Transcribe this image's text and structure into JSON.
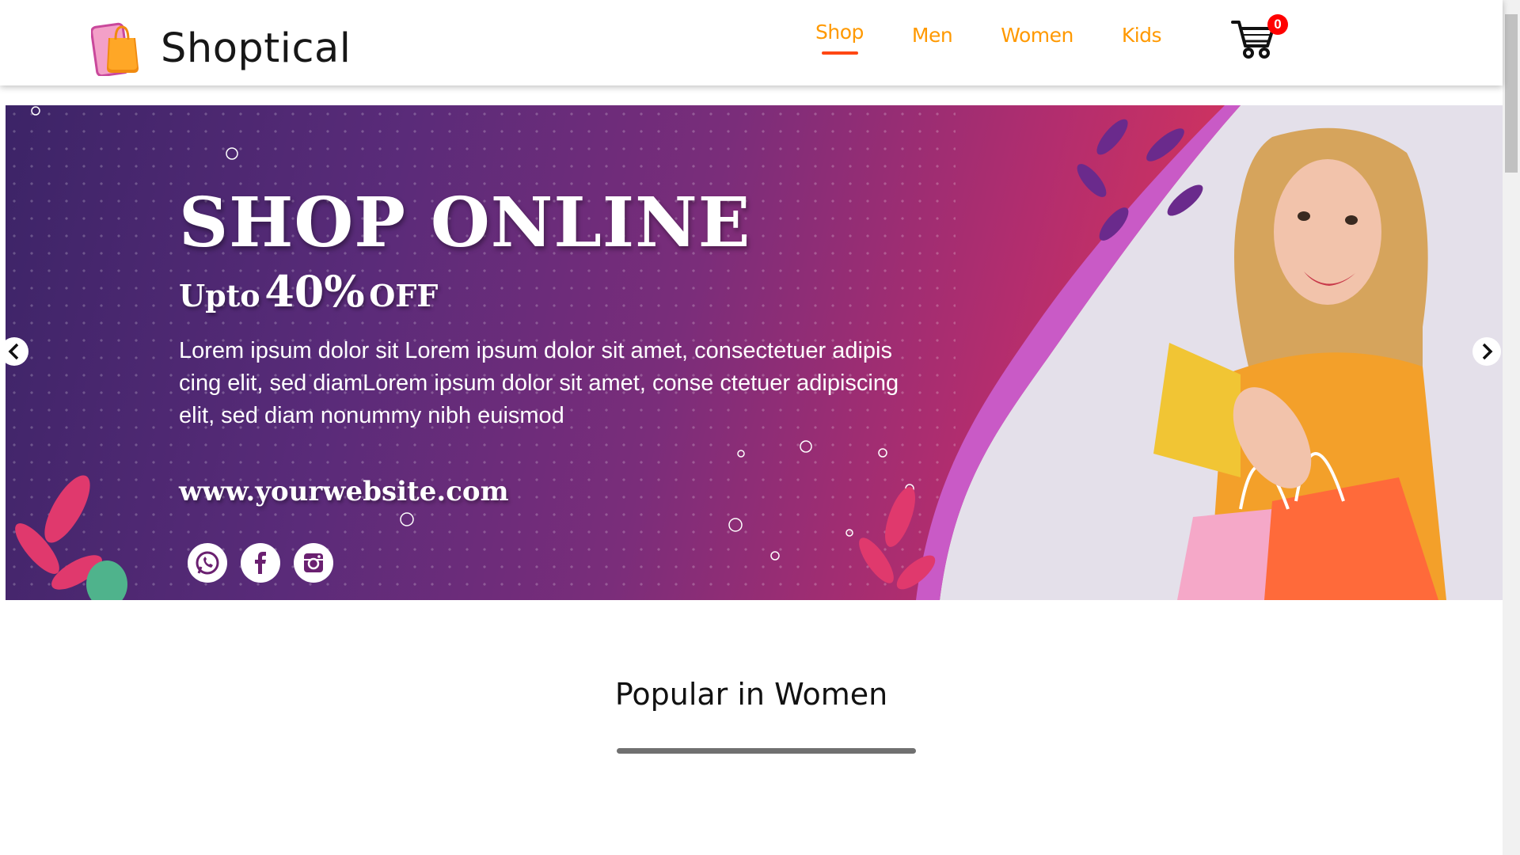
{
  "brand": {
    "name": "Shoptical",
    "logo_icon": "shopping-bag-phone-icon"
  },
  "nav": {
    "items": [
      {
        "label": "Shop",
        "active": true
      },
      {
        "label": "Men",
        "active": false
      },
      {
        "label": "Women",
        "active": false
      },
      {
        "label": "Kids",
        "active": false
      }
    ],
    "cart_count": "0",
    "accent_color": "#ff9900",
    "active_underline_color": "#ff4713",
    "badge_color": "#ff0000"
  },
  "hero": {
    "title": "SHOP ONLINE",
    "subtitle_prefix": "Upto",
    "subtitle_percent": "40%",
    "subtitle_suffix": "OFF",
    "body": "Lorem ipsum dolor sit Lorem ipsum dolor sit amet, consectetuer adipis cing elit, sed diamLorem ipsum dolor sit amet, conse ctetuer adipiscing elit, sed diam nonummy nibh euismod",
    "url": "www.yourwebsite.com",
    "socials": [
      "whatsapp-icon",
      "facebook-icon",
      "instagram-icon"
    ],
    "prev_icon": "chevron-left-icon",
    "next_icon": "chevron-right-icon"
  },
  "section": {
    "title": "Popular in Women"
  }
}
